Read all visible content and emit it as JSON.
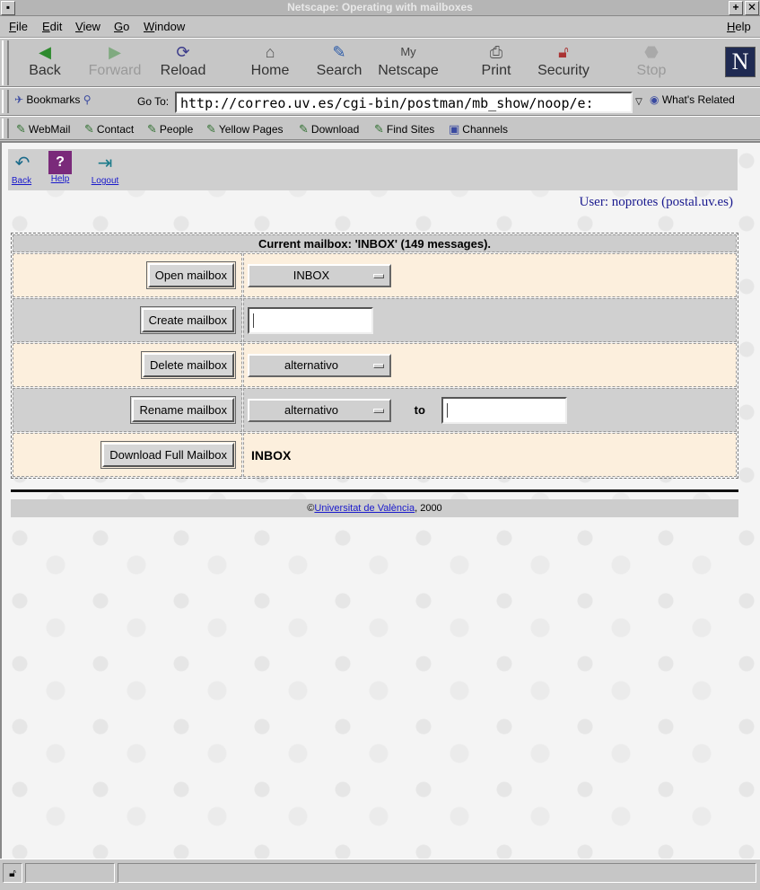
{
  "window": {
    "title": "Netscape: Operating with mailboxes"
  },
  "menu": {
    "file": "File",
    "edit": "Edit",
    "view": "View",
    "go": "Go",
    "window": "Window",
    "help": "Help"
  },
  "toolbar": {
    "back": "Back",
    "forward": "Forward",
    "reload": "Reload",
    "home": "Home",
    "search": "Search",
    "netscape": "Netscape",
    "print": "Print",
    "security": "Security",
    "stop": "Stop"
  },
  "location": {
    "bookmarks": "Bookmarks",
    "goto": "Go To:",
    "url": "http://correo.uv.es/cgi-bin/postman/mb_show/noop/e:",
    "related": "What's Related"
  },
  "personal": {
    "webmail": "WebMail",
    "contact": "Contact",
    "people": "People",
    "yellow": "Yellow Pages",
    "download": "Download",
    "find": "Find Sites",
    "channels": "Channels"
  },
  "page_nav": {
    "back": "Back",
    "help": "Help",
    "logout": "Logout"
  },
  "user_line": "User: noprotes (postal.uv.es)",
  "mailbox": {
    "header": "Current mailbox: 'INBOX' (149 messages).",
    "open_label": "Open mailbox",
    "open_select": "INBOX",
    "create_label": "Create mailbox",
    "delete_label": "Delete mailbox",
    "delete_select": "alternativo",
    "rename_label": "Rename mailbox",
    "rename_select": "alternativo",
    "rename_to": "to",
    "download_label": "Download Full Mailbox",
    "download_value": "INBOX"
  },
  "footer": {
    "copy": "©",
    "link": "Universitat de València",
    "year": ", 2000"
  }
}
